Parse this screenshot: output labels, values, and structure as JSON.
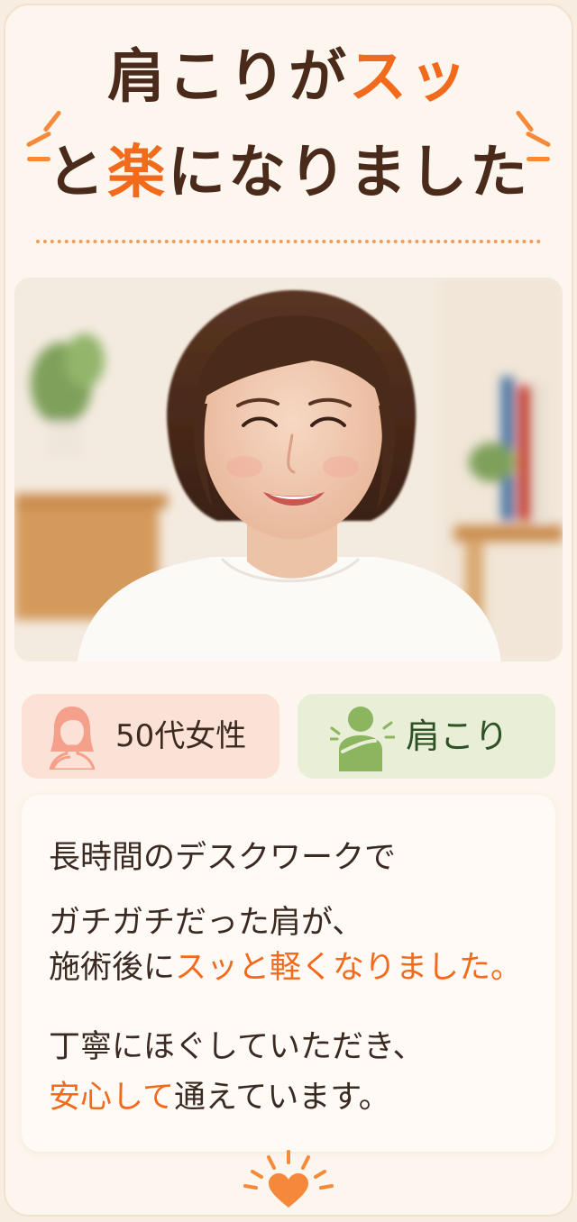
{
  "headline": {
    "line1_main": "肩こりが",
    "line1_accent": "スッ",
    "line2_pre": "と",
    "line2_accent": "楽",
    "line2_post": "になりました"
  },
  "tags": {
    "age": {
      "label": "50代女性",
      "icon": "woman-icon"
    },
    "symptom": {
      "label": "肩こり",
      "icon": "shoulder-pain-icon"
    }
  },
  "testimonial": {
    "l1": "長時間のデスクワークで",
    "l2": "ガチガチだった肩が、",
    "l3_pre": "施術後に",
    "l3_hl": "スッと軽くなりました。",
    "l4": "丁寧にほぐしていただき、",
    "l5_hl": "安心して",
    "l5_post": "通えています。"
  },
  "decor": {
    "heart_icon": "heart-icon",
    "spark_icon": "sparkle-lines-icon"
  },
  "colors": {
    "accent": "#f26b1d",
    "text_brown": "#4a2a1a",
    "card_bg": "#fdf6ee",
    "age_tag_bg": "#fbe1d6",
    "symptom_tag_bg": "#e9efd6",
    "symptom_text": "#2e5226"
  }
}
